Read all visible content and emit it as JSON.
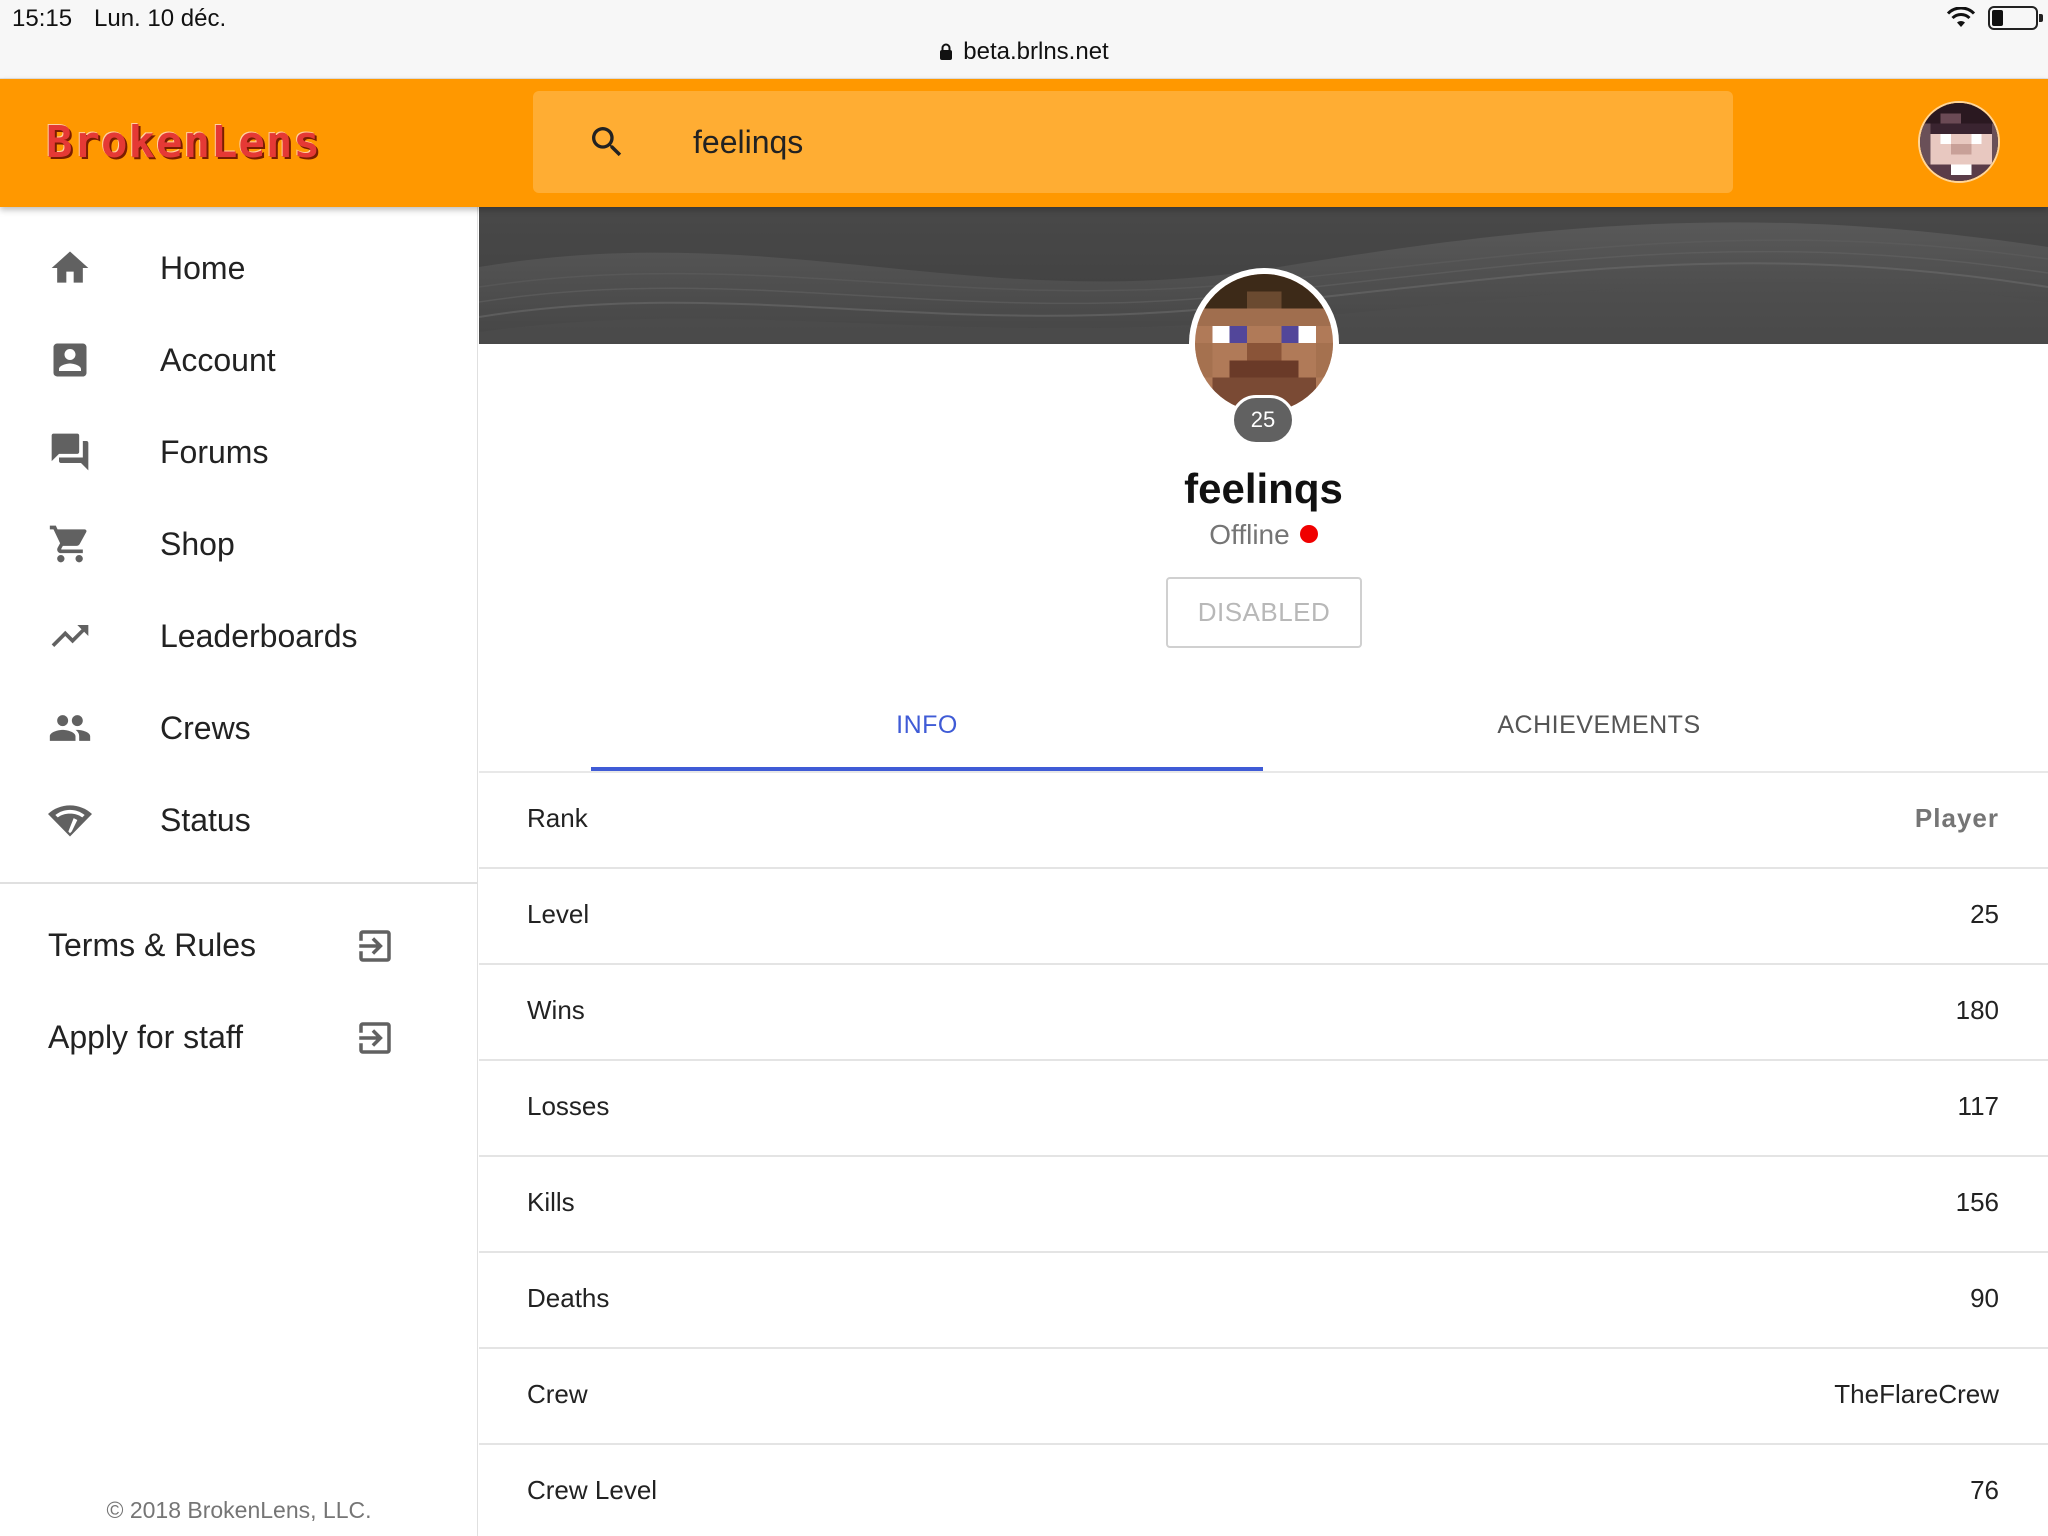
{
  "status_bar": {
    "time": "15:15",
    "date": "Lun. 10 déc.",
    "url": "beta.brlns.net",
    "battery_level": 0.25
  },
  "app_bar": {
    "logo": "BrokenLens",
    "search_value": "feelinqs",
    "accent_color": "#ff9800"
  },
  "sidebar": {
    "items": [
      {
        "label": "Home",
        "icon": "home-icon"
      },
      {
        "label": "Account",
        "icon": "account-box-icon"
      },
      {
        "label": "Forums",
        "icon": "forum-icon"
      },
      {
        "label": "Shop",
        "icon": "cart-icon"
      },
      {
        "label": "Leaderboards",
        "icon": "trending-up-icon"
      },
      {
        "label": "Crews",
        "icon": "people-icon"
      },
      {
        "label": "Status",
        "icon": "signal-icon"
      }
    ],
    "external": [
      {
        "label": "Terms & Rules",
        "icon": "exit-to-app-icon"
      },
      {
        "label": "Apply for staff",
        "icon": "exit-to-app-icon"
      }
    ],
    "copyright": "© 2018 BrokenLens, LLC."
  },
  "profile": {
    "level_badge": "25",
    "username": "feelinqs",
    "status": "Offline",
    "status_color": "#f00000",
    "action_button": "DISABLED"
  },
  "tabs": {
    "info": "INFO",
    "achievements": "ACHIEVEMENTS",
    "active_color": "#3f5bd6"
  },
  "info_rows": [
    {
      "label": "Rank",
      "value": "Player"
    },
    {
      "label": "Level",
      "value": "25"
    },
    {
      "label": "Wins",
      "value": "180"
    },
    {
      "label": "Losses",
      "value": "117"
    },
    {
      "label": "Kills",
      "value": "156"
    },
    {
      "label": "Deaths",
      "value": "90"
    },
    {
      "label": "Crew",
      "value": "TheFlareCrew"
    },
    {
      "label": "Crew Level",
      "value": "76"
    }
  ]
}
